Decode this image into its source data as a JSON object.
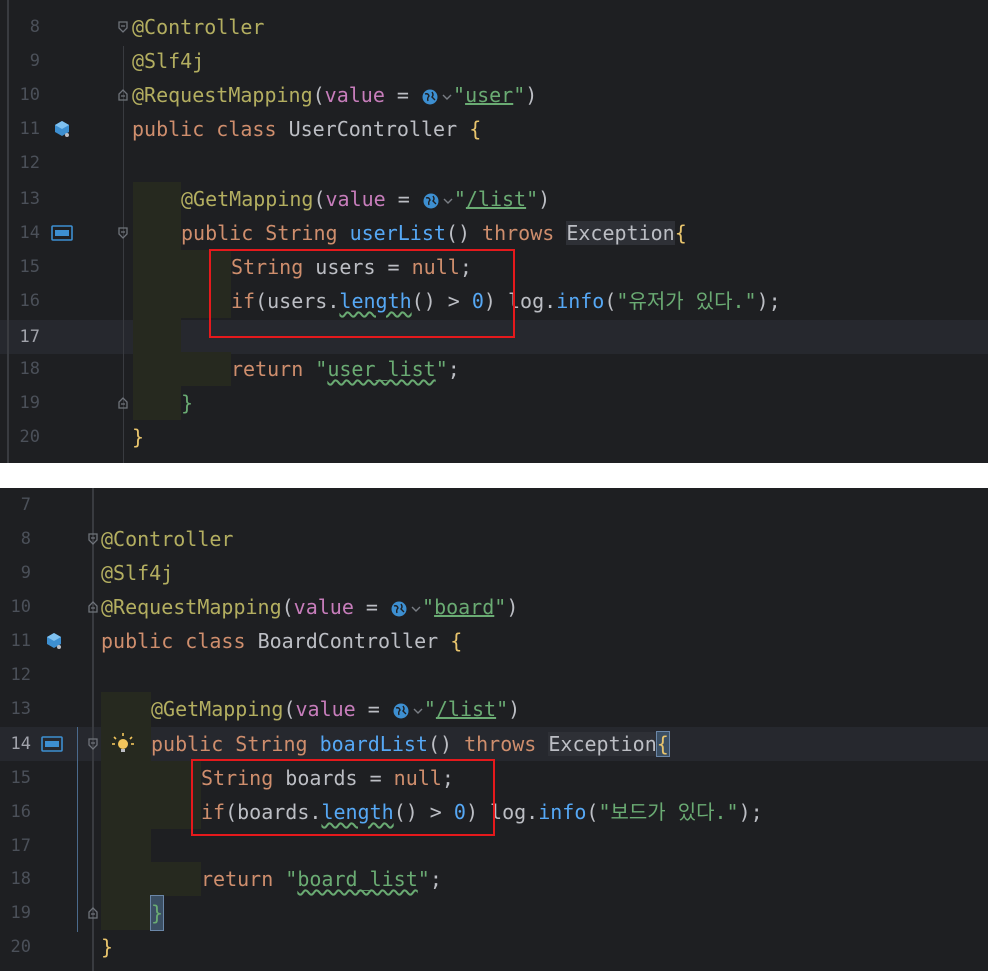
{
  "top_editor": {
    "lines": [
      {
        "num": "8",
        "text": "@Controller"
      },
      {
        "num": "9",
        "text": "@Slf4j"
      },
      {
        "num": "10",
        "text": "@RequestMapping(value = \"user\")"
      },
      {
        "num": "11",
        "text": "public class UserController {"
      },
      {
        "num": "12",
        "text": ""
      },
      {
        "num": "13",
        "text": "@GetMapping(value = \"/list\")"
      },
      {
        "num": "14",
        "text": "public String userList() throws Exception{"
      },
      {
        "num": "15",
        "text": "String users = null;"
      },
      {
        "num": "16",
        "text": "if(users.length() > 0) log.info(\"유저가 있다.\");"
      },
      {
        "num": "17",
        "text": ""
      },
      {
        "num": "18",
        "text": "return \"user_list\";"
      },
      {
        "num": "19",
        "text": "}"
      },
      {
        "num": "20",
        "text": "}"
      }
    ],
    "current_line": "17"
  },
  "bottom_editor": {
    "lines": [
      {
        "num": "7",
        "text": ""
      },
      {
        "num": "8",
        "text": "@Controller"
      },
      {
        "num": "9",
        "text": "@Slf4j"
      },
      {
        "num": "10",
        "text": "@RequestMapping(value = \"board\")"
      },
      {
        "num": "11",
        "text": "public class BoardController {"
      },
      {
        "num": "12",
        "text": ""
      },
      {
        "num": "13",
        "text": "@GetMapping(value = \"/list\")"
      },
      {
        "num": "14",
        "text": "public String boardList() throws Exception{"
      },
      {
        "num": "15",
        "text": "String boards = null;"
      },
      {
        "num": "16",
        "text": "if(boards.length() > 0) log.info(\"보드가 있다.\");"
      },
      {
        "num": "17",
        "text": ""
      },
      {
        "num": "18",
        "text": "return \"board_list\";"
      },
      {
        "num": "19",
        "text": "}"
      },
      {
        "num": "20",
        "text": "}"
      }
    ],
    "current_line": "14"
  },
  "gutter_icons": {
    "bean_class": "bean-class-icon",
    "api_method": "api-endpoint-icon",
    "intention": "lightbulb-icon",
    "fold": "fold-arrow-icon",
    "url_globe": "globe-icon",
    "url_dropdown": "chevron-down-icon"
  },
  "colors": {
    "editor_bg": "#1e1f22",
    "current_line_bg": "#26282e",
    "keyword": "#cf8e6d",
    "annotation": "#b3ae60",
    "string": "#6aab73",
    "method_call": "#56a8f5",
    "property": "#c77dbb",
    "highlight_box": "#e5191c"
  }
}
